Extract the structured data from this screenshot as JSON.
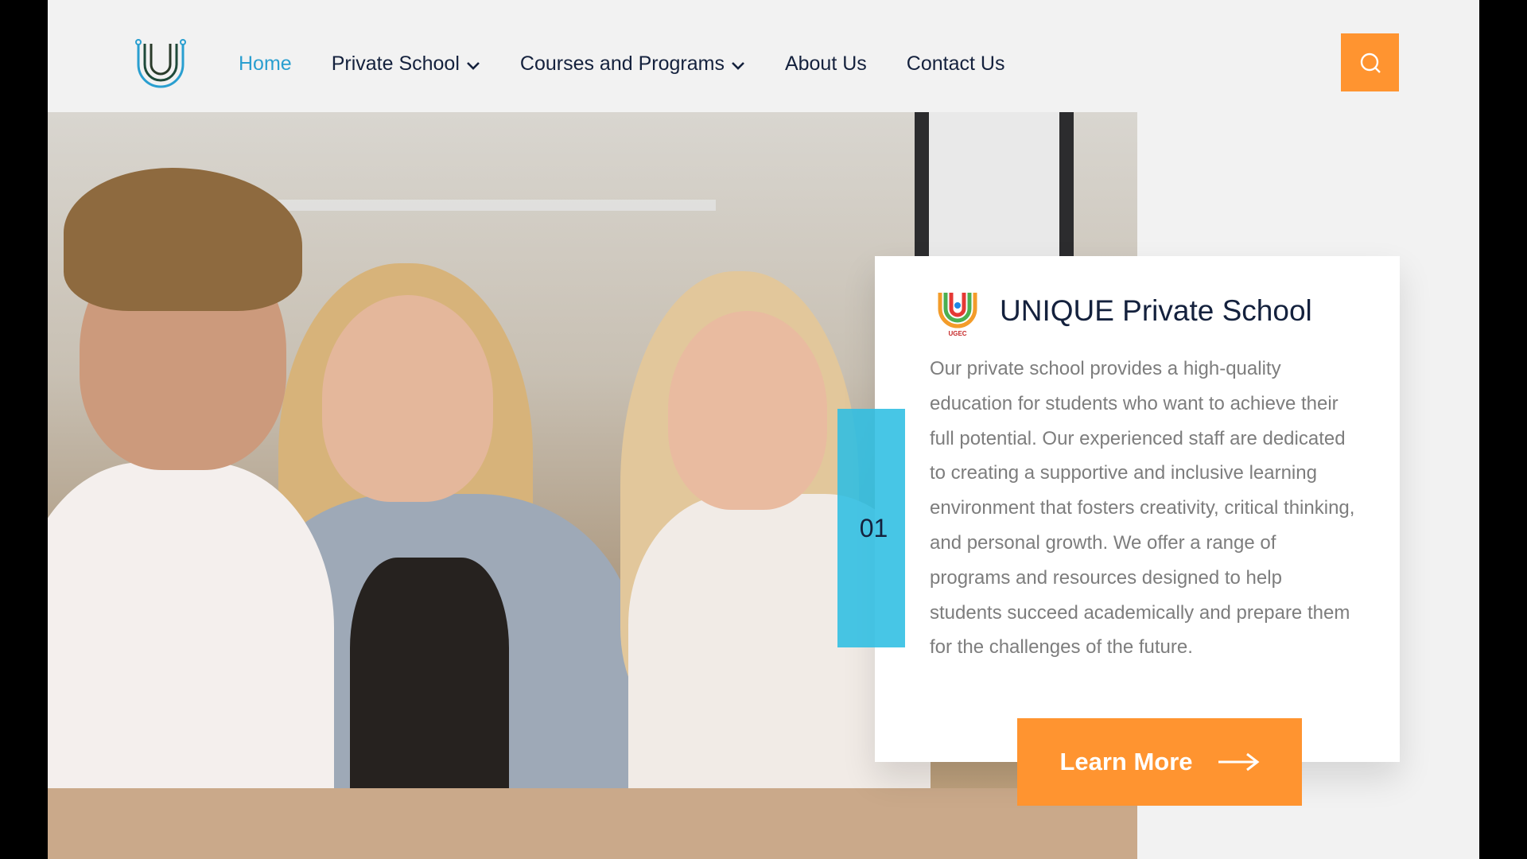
{
  "header": {
    "logo_icon": "u-monogram-logo",
    "nav": [
      {
        "label": "Home",
        "active": true,
        "dropdown": false
      },
      {
        "label": "Private School",
        "active": false,
        "dropdown": true
      },
      {
        "label": "Courses and Programs",
        "active": false,
        "dropdown": true
      },
      {
        "label": "About Us",
        "active": false,
        "dropdown": false
      },
      {
        "label": "Contact Us",
        "active": false,
        "dropdown": false
      }
    ],
    "search_icon": "search-icon"
  },
  "hero": {
    "image_desc": "three-smiling-students-at-table-photo"
  },
  "card": {
    "logo_text": "UGEC",
    "number": "01",
    "title": "UNIQUE Private School",
    "body": "Our private school provides a high-quality education for students who want to achieve their full potential. Our experienced staff are dedicated to creating a supportive and inclusive learning environment that fosters creativity, critical thinking, and personal growth. We offer a range of programs and resources designed to help students succeed academically and prepare them for the challenges of the future.",
    "cta_label": "Learn More"
  },
  "colors": {
    "accent": "#ff9430",
    "nav_active": "#2a9fd0",
    "nav_text": "#14213d",
    "tab": "#2ebee2"
  }
}
